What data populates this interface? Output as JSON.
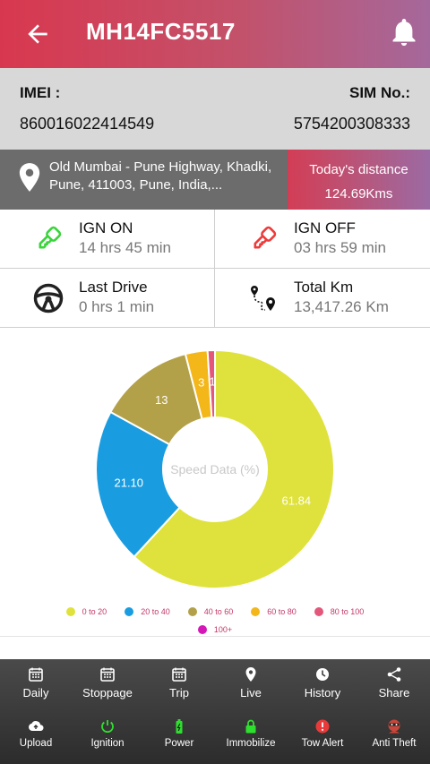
{
  "header": {
    "title": "MH14FC5517",
    "back_icon": "arrow-left-icon",
    "bell_icon": "bell-icon"
  },
  "device": {
    "imei_label": "IMEI :",
    "imei_value": "860016022414549",
    "sim_label": "SIM No.:",
    "sim_value": "5754200308333"
  },
  "location": {
    "address": "Old Mumbai - Pune Highway, Khadki, Pune, 411003, Pune, India,...",
    "distance_label": "Today's distance",
    "distance_value": "124.69Kms"
  },
  "stats": [
    {
      "label": "IGN ON",
      "value": "14 hrs 45 min",
      "icon": "key-green-icon"
    },
    {
      "label": "IGN OFF",
      "value": "03 hrs 59 min",
      "icon": "key-red-icon"
    },
    {
      "label": "Last Drive",
      "value": "0 hrs 1 min",
      "icon": "steering-wheel-icon"
    },
    {
      "label": "Total Km",
      "value": "13,417.26 Km",
      "icon": "route-icon"
    }
  ],
  "chart_data": {
    "type": "pie",
    "title": "Speed Data (%)",
    "categories": [
      "0 to 20",
      "20 to 40",
      "40 to 60",
      "60 to 80",
      "80 to 100",
      "100+"
    ],
    "values": [
      61.84,
      21.1,
      13,
      3,
      1,
      0
    ],
    "labels": [
      "61.84",
      "21.10",
      "13",
      "3",
      "1",
      ""
    ],
    "colors": [
      "#dfe23d",
      "#1a9de0",
      "#b3a149",
      "#f3b71a",
      "#e2577a",
      "#d418b8"
    ],
    "legend": "bottom"
  },
  "nav_row1": [
    {
      "label": "Daily",
      "icon": "calendar-icon"
    },
    {
      "label": "Stoppage",
      "icon": "calendar-icon"
    },
    {
      "label": "Trip",
      "icon": "calendar-icon"
    },
    {
      "label": "Live",
      "icon": "location-pin-icon"
    },
    {
      "label": "History",
      "icon": "history-icon"
    },
    {
      "label": "Share",
      "icon": "share-icon"
    }
  ],
  "nav_row2": [
    {
      "label": "Upload",
      "icon": "cloud-upload-icon"
    },
    {
      "label": "Ignition",
      "icon": "power-icon"
    },
    {
      "label": "Power",
      "icon": "battery-icon"
    },
    {
      "label": "Immobilize",
      "icon": "lock-icon"
    },
    {
      "label": "Tow Alert",
      "icon": "alert-icon"
    },
    {
      "label": "Anti Theft",
      "icon": "thief-icon"
    }
  ]
}
